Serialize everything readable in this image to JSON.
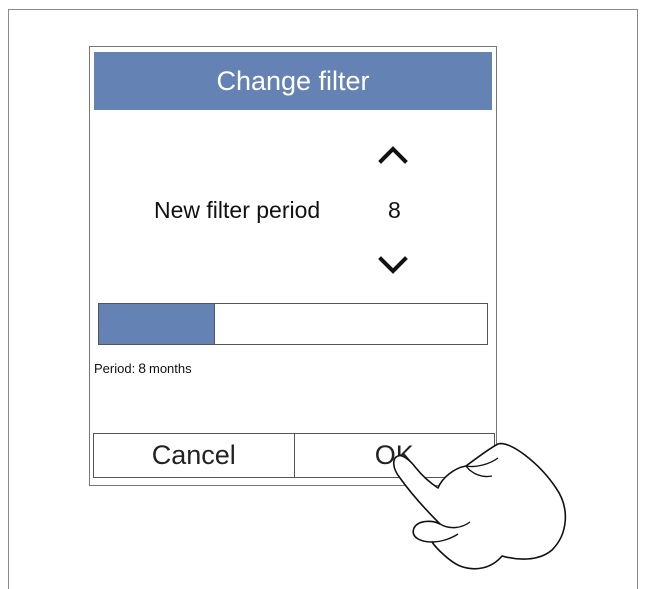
{
  "dialog": {
    "title": "Change filter",
    "period_label": "New filter period",
    "period_value": "8",
    "up_icon": "chevron-up-icon",
    "down_icon": "chevron-down-icon",
    "progress_fraction": 0.3,
    "status": {
      "prefix": "Period:",
      "value": "8",
      "unit": "months"
    },
    "cancel_label": "Cancel",
    "ok_label": "OK"
  },
  "overlay": {
    "hand_icon": "pointing-hand-icon"
  },
  "colors": {
    "accent": "#6482b4",
    "border": "#555555"
  }
}
